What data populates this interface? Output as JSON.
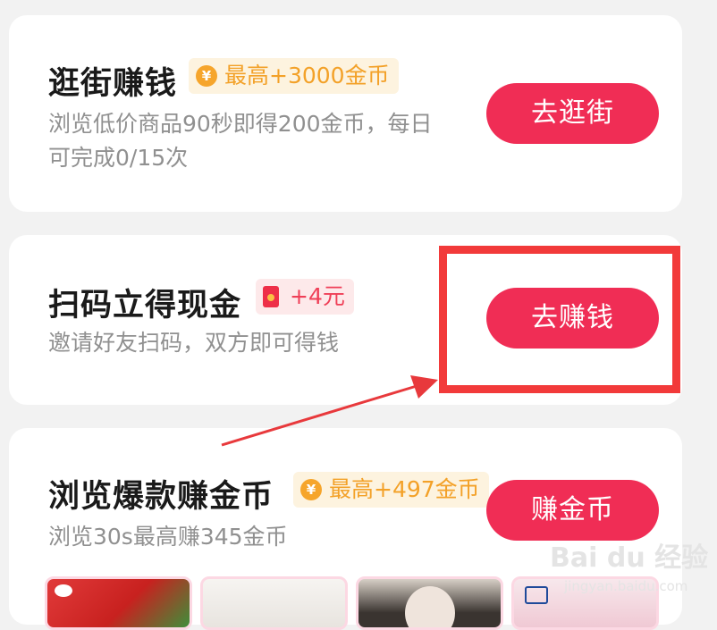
{
  "tasks": [
    {
      "title": "逛街赚钱",
      "badge": "最高+3000金币",
      "badge_icon": "coin-icon",
      "desc_line1": "浏览低价商品90秒即得200金币，每日",
      "desc_line2": "可完成0/15次",
      "button": "去逛街"
    },
    {
      "title": "扫码立得现金",
      "badge": "+4元",
      "badge_icon": "red-envelope-icon",
      "desc_line1": "邀请好友扫码，双方即可得钱",
      "button": "去赚钱"
    },
    {
      "title": "浏览爆款赚金币",
      "badge": "最高+497金币",
      "badge_icon": "coin-icon",
      "desc_line1": "浏览30s最高赚345金币",
      "button": "赚金币"
    }
  ],
  "coin_glyph": "¥",
  "annotation": {
    "highlight_color": "#f23a3a",
    "arrow_color": "#e8393c"
  },
  "watermark": {
    "main": "Bai du 经验",
    "sub": "jingyan.baidu.com"
  },
  "colors": {
    "accent": "#f02d55",
    "coin_badge_bg": "#fdf3df",
    "coin_badge_text": "#f3a128",
    "cash_badge_bg": "#fde9ea",
    "cash_badge_text": "#ef3f57"
  }
}
